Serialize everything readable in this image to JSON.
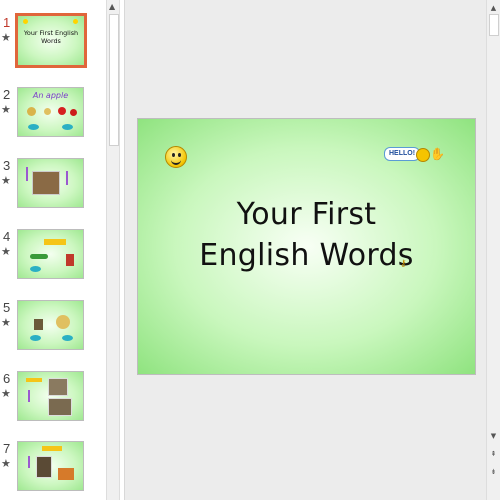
{
  "thumbnails": [
    {
      "number": "1",
      "star": "★",
      "title": "Your First English Words"
    },
    {
      "number": "2",
      "star": "★",
      "title": "An apple"
    },
    {
      "number": "3",
      "star": "★"
    },
    {
      "number": "4",
      "star": "★"
    },
    {
      "number": "5",
      "star": "★"
    },
    {
      "number": "6",
      "star": "★"
    },
    {
      "number": "7",
      "star": "★"
    }
  ],
  "slide": {
    "title_line1": "Your First",
    "title_line2": "English Words",
    "hello": "HELLO!"
  },
  "scroll": {
    "up": "▲",
    "down": "▼",
    "prev": "⇞",
    "next": "⇟"
  },
  "icons": {
    "thumb_star": "star-icon",
    "smiley": "smiley-icon",
    "hand": "hand-wave-icon",
    "key": "key-icon"
  },
  "colors": {
    "active_border": "#e0663b",
    "slide_green": "#c9f7bd",
    "slide_green_edge": "#8fe37f"
  }
}
